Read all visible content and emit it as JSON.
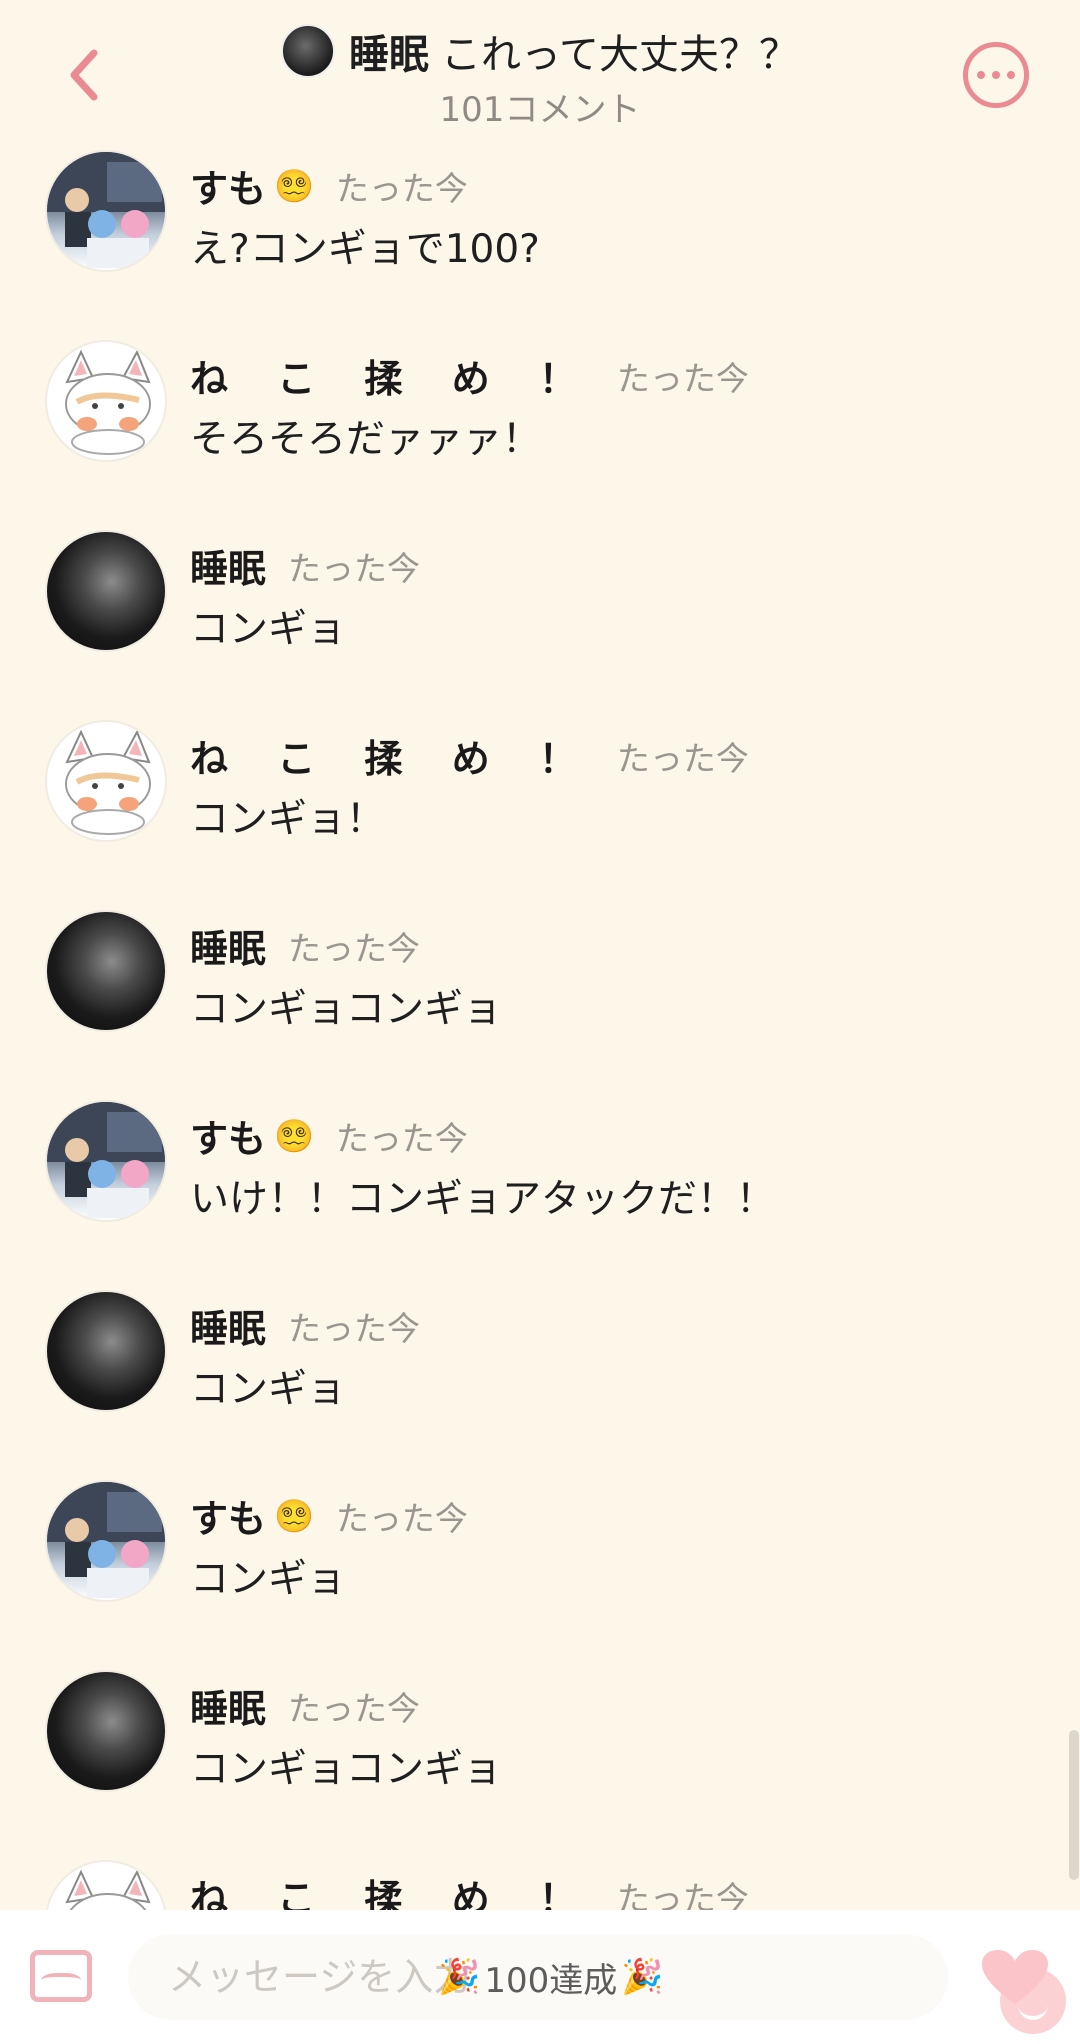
{
  "header": {
    "title_name": "睡眠",
    "title_text": "これって大丈夫？？",
    "subtitle": "101コメント",
    "back_icon": "chevron-left-icon",
    "more_icon": "more-horizontal-icon",
    "accent_color": "#ea8a93"
  },
  "messages": [
    {
      "user": "すも",
      "badge": "😵‍💫",
      "time": "たった今",
      "text": "え?コンギョで100?",
      "avatar": "sumo"
    },
    {
      "user": "ね こ 揉 め ！",
      "badge": "",
      "time": "たった今",
      "text": "そろそろだァァァ！",
      "avatar": "neko"
    },
    {
      "user": "睡眠",
      "badge": "",
      "time": "たった今",
      "text": "コンギョ",
      "avatar": "sleep"
    },
    {
      "user": "ね こ 揉 め ！",
      "badge": "",
      "time": "たった今",
      "text": "コンギョ！",
      "avatar": "neko"
    },
    {
      "user": "睡眠",
      "badge": "",
      "time": "たった今",
      "text": "コンギョコンギョ",
      "avatar": "sleep"
    },
    {
      "user": "すも",
      "badge": "😵‍💫",
      "time": "たった今",
      "text": "いけ！！コンギョアタックだ！！",
      "avatar": "sumo"
    },
    {
      "user": "睡眠",
      "badge": "",
      "time": "たった今",
      "text": "コンギョ",
      "avatar": "sleep"
    },
    {
      "user": "すも",
      "badge": "😵‍💫",
      "time": "たった今",
      "text": "コンギョ",
      "avatar": "sumo"
    },
    {
      "user": "睡眠",
      "badge": "",
      "time": "たった今",
      "text": "コンギョコンギョ",
      "avatar": "sleep"
    },
    {
      "user": "ね こ 揉 め ！",
      "badge": "",
      "time": "たった今",
      "text": "",
      "avatar": "neko"
    }
  ],
  "composer": {
    "placeholder": "メッセージを入力",
    "banner": "100達成",
    "confetti_icon": "🎉",
    "image_icon": "image-icon",
    "stamp_icon": "smile-stamp-icon",
    "heart_icon": "heart-icon"
  }
}
